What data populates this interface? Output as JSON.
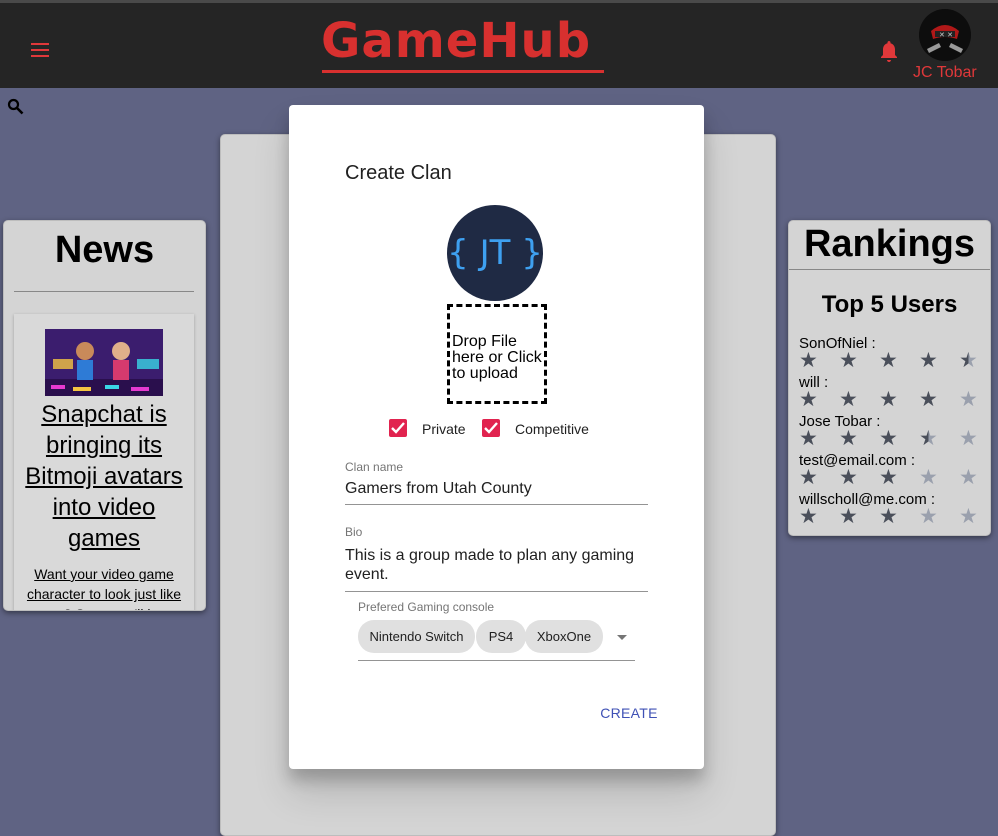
{
  "header": {
    "logo": "GameHub",
    "username": "JC Tobar"
  },
  "icons": {
    "menu": "menu-icon",
    "bell": "bell-icon",
    "search": "search-icon"
  },
  "colors": {
    "appbar": "#252525",
    "brand": "#d8302f",
    "background": "#5f6383",
    "checkbox": "#e1234f",
    "action": "#3f51b5"
  },
  "news": {
    "title": "News",
    "headline": "Snapchat is bringing its Bitmoji avatars into video games",
    "snippet": "Want your video game character to look just like you? Soon you'll b..."
  },
  "rankings": {
    "title": "Rankings",
    "subtitle": "Top 5 Users",
    "users": [
      {
        "label": "SonOfNiel :",
        "rating": 4.5
      },
      {
        "label": "will :",
        "rating": 4
      },
      {
        "label": "Jose Tobar :",
        "rating": 3.5
      },
      {
        "label": "test@email.com :",
        "rating": 3
      },
      {
        "label": "willscholl@me.com :",
        "rating": 3
      }
    ]
  },
  "dialog": {
    "title": "Create Clan",
    "avatar_text": "{ JT }",
    "dropzone_text": "Drop File here or Click to upload",
    "checkboxes": [
      {
        "label": "Private",
        "checked": true
      },
      {
        "label": "Competitive",
        "checked": true
      }
    ],
    "clan_name": {
      "label": "Clan name",
      "value": "Gamers from Utah County"
    },
    "bio": {
      "label": "Bio",
      "value": "This is a group made to plan any gaming event."
    },
    "console": {
      "label": "Prefered Gaming console",
      "selected": [
        "Nintendo Switch",
        "PS4",
        "XboxOne"
      ]
    },
    "create_label": "CREATE"
  }
}
